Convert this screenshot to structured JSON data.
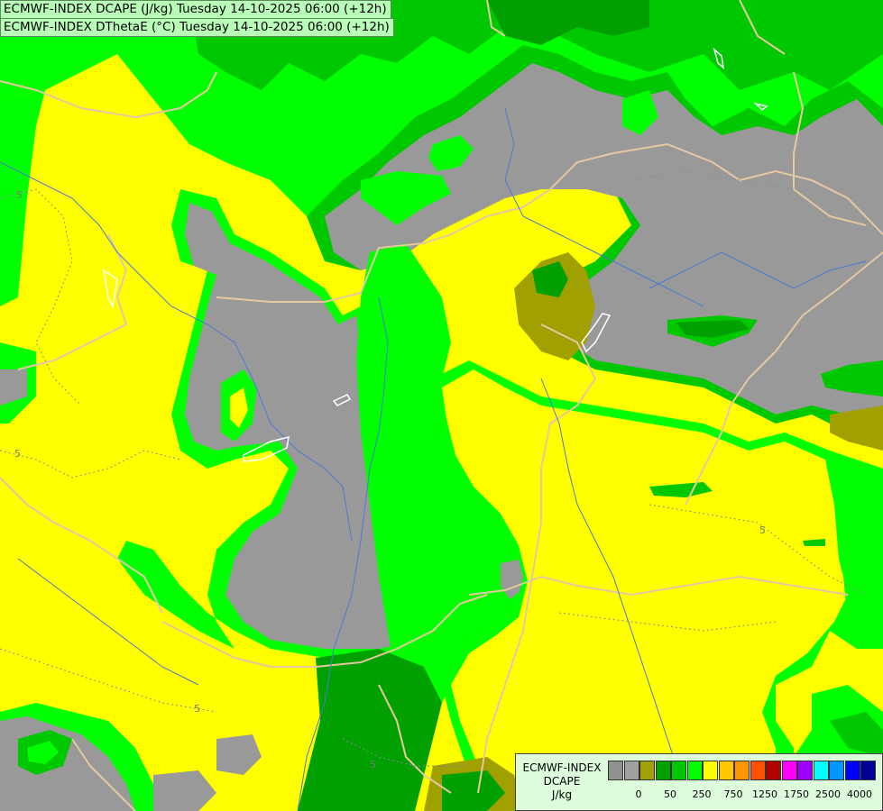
{
  "titles": {
    "line1": "ECMWF-INDEX DCAPE (J/kg) Tuesday 14-10-2025 06:00 (+12h)",
    "line2": "ECMWF-INDEX DThetaE (°C) Tuesday 14-10-2025 06:00 (+12h)"
  },
  "legend": {
    "title_line1": "ECMWF-INDEX",
    "title_line2": "DCAPE",
    "unit": "J/kg",
    "colors": [
      "#909090",
      "#a0a0a0",
      "#a0a000",
      "#00a000",
      "#00c800",
      "#00ff00",
      "#ffff00",
      "#ffc800",
      "#ff9600",
      "#ff5000",
      "#b00000",
      "#ff00ff",
      "#a000ff",
      "#00ffff",
      "#0096ff",
      "#0000ff",
      "#000096"
    ],
    "tick_labels": [
      "0",
      "50",
      "250",
      "750",
      "1250",
      "1750",
      "2500",
      "4000"
    ]
  },
  "contour_labels": [
    "5",
    "5",
    "5",
    "5",
    "5"
  ],
  "colors": {
    "gray": "#999999",
    "olive": "#a0a000",
    "dark_green": "#00a000",
    "green": "#00dc00",
    "light_green": "#00ff00",
    "yellow": "#ffff00",
    "border": "#e6c8a0",
    "river": "#4a7ad0"
  }
}
